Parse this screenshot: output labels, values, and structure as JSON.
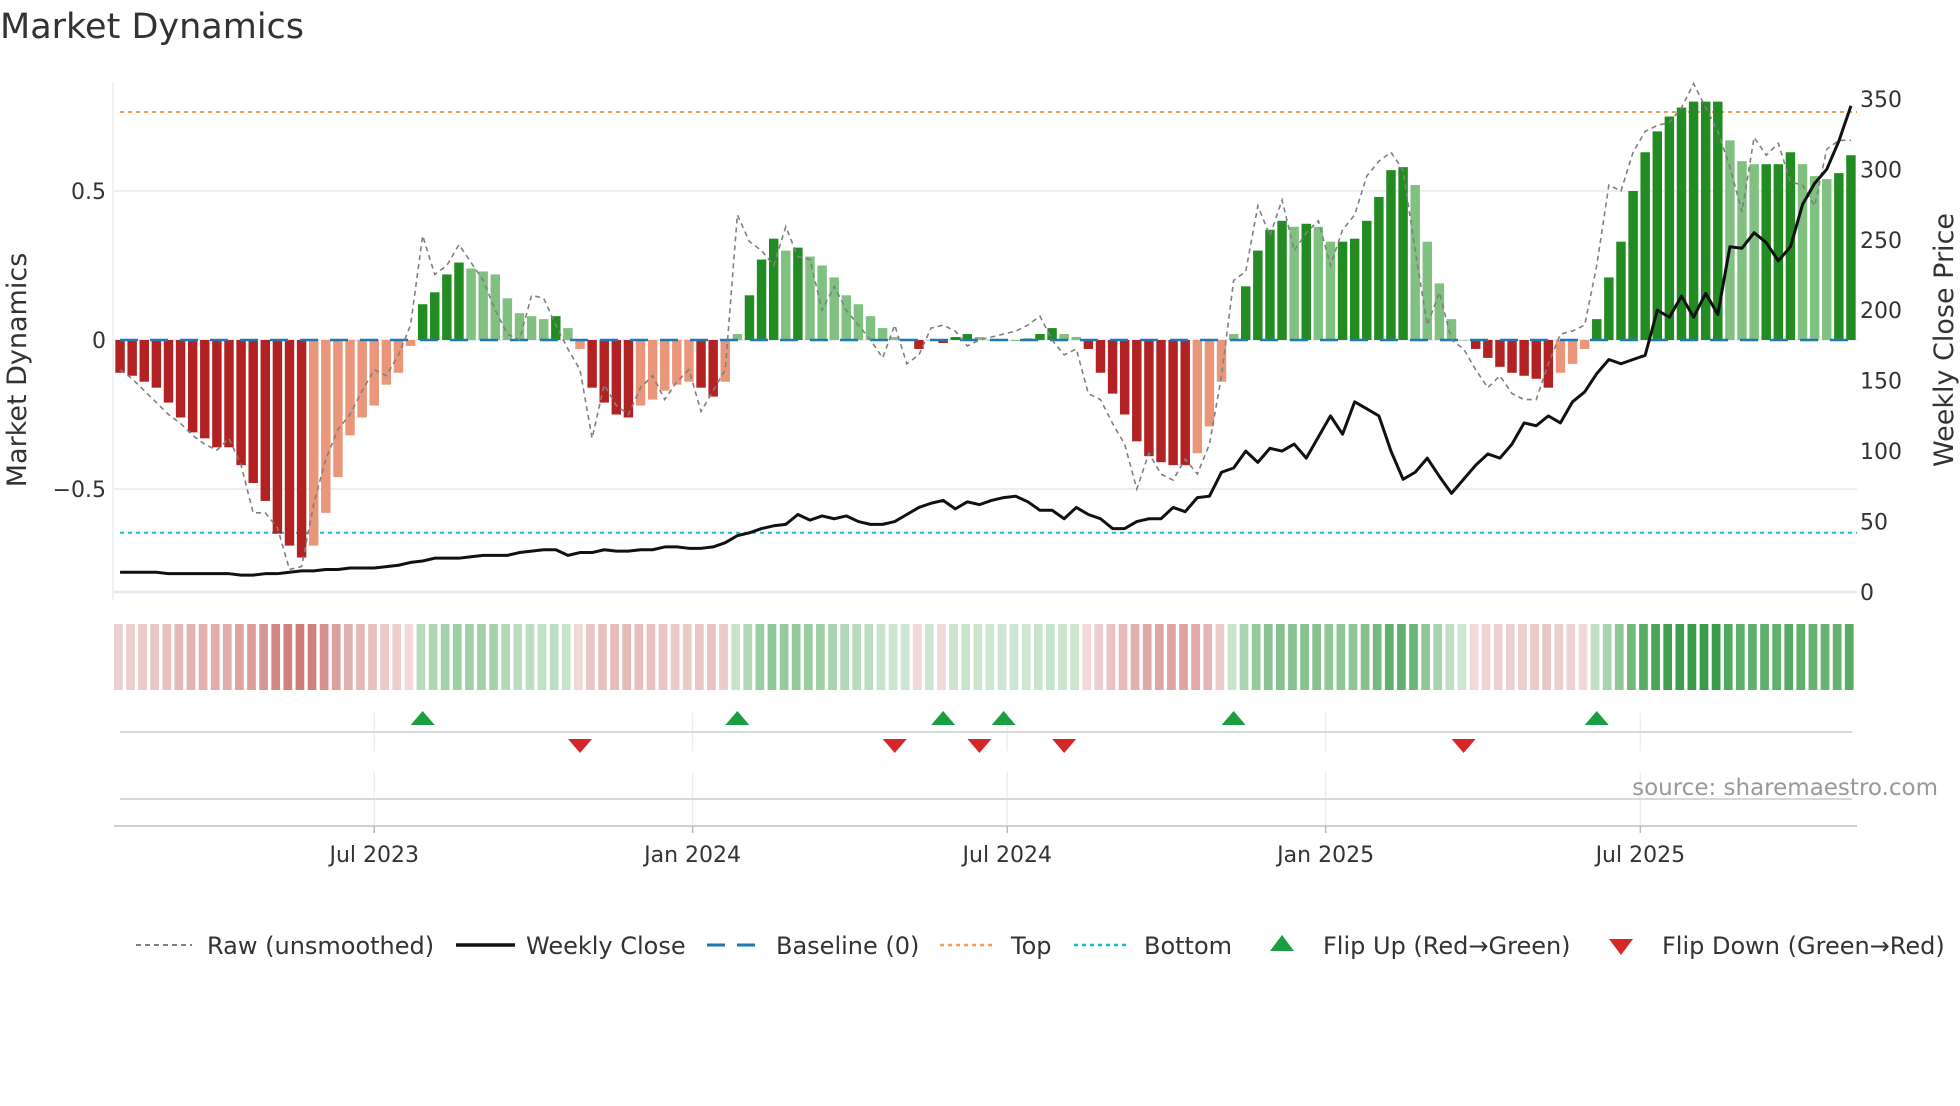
{
  "chart_data": {
    "type": "bar",
    "title": "Market Dynamics",
    "ylabel": "Market Dynamics",
    "y2label": "Weekly Close Price",
    "ylim": [
      -0.84,
      0.87
    ],
    "y2lim": [
      0,
      365
    ],
    "yticks": [
      -0.5,
      0,
      0.5
    ],
    "ytick_labels": [
      "−0.5",
      "0",
      "0.5"
    ],
    "y2ticks": [
      0,
      50,
      100,
      150,
      200,
      250,
      300,
      350
    ],
    "y2tick_labels": [
      "0",
      "50",
      "100",
      "150",
      "200",
      "250",
      "300",
      "350"
    ],
    "frequency": "weekly",
    "start_date": "2023-02-03",
    "xtick_labels": [
      "Jul 2023",
      "Jan 2024",
      "Jul 2024",
      "Jan 2025",
      "Jul 2025"
    ],
    "xtick_week_index": [
      21,
      47.3,
      73.3,
      99.6,
      125.6
    ],
    "top_level": 0.765,
    "bottom_level": -0.647,
    "baseline": 0,
    "smoothed": [
      -0.11,
      -0.12,
      -0.14,
      -0.16,
      -0.21,
      -0.26,
      -0.31,
      -0.33,
      -0.36,
      -0.36,
      -0.42,
      -0.48,
      -0.54,
      -0.65,
      -0.69,
      -0.73,
      -0.69,
      -0.58,
      -0.46,
      -0.32,
      -0.26,
      -0.22,
      -0.15,
      -0.11,
      -0.02,
      0.12,
      0.16,
      0.22,
      0.26,
      0.24,
      0.23,
      0.22,
      0.14,
      0.09,
      0.08,
      0.07,
      0.08,
      0.04,
      -0.03,
      -0.16,
      -0.21,
      -0.25,
      -0.26,
      -0.22,
      -0.2,
      -0.17,
      -0.15,
      -0.14,
      -0.16,
      -0.19,
      -0.14,
      0.02,
      0.15,
      0.27,
      0.34,
      0.3,
      0.31,
      0.28,
      0.25,
      0.21,
      0.15,
      0.12,
      0.08,
      0.04,
      0.01,
      0.0,
      -0.03,
      0.0,
      -0.01,
      0.01,
      0.02,
      0.01,
      0.0,
      0.0,
      0.0,
      0.005,
      0.02,
      0.04,
      0.02,
      0.01,
      -0.03,
      -0.11,
      -0.18,
      -0.25,
      -0.34,
      -0.39,
      -0.41,
      -0.42,
      -0.42,
      -0.38,
      -0.29,
      -0.14,
      0.02,
      0.18,
      0.3,
      0.37,
      0.4,
      0.38,
      0.39,
      0.38,
      0.33,
      0.33,
      0.34,
      0.4,
      0.48,
      0.57,
      0.58,
      0.52,
      0.33,
      0.19,
      0.07,
      0.0,
      -0.03,
      -0.06,
      -0.09,
      -0.11,
      -0.12,
      -0.13,
      -0.16,
      -0.11,
      -0.08,
      -0.03,
      0.07,
      0.21,
      0.33,
      0.5,
      0.63,
      0.7,
      0.75,
      0.78,
      0.8,
      0.8,
      0.8,
      0.67,
      0.6,
      0.59,
      0.59,
      0.59,
      0.63,
      0.59,
      0.55,
      0.54,
      0.56,
      0.62
    ],
    "raw": [
      -0.1,
      -0.13,
      -0.17,
      -0.21,
      -0.25,
      -0.28,
      -0.32,
      -0.35,
      -0.37,
      -0.33,
      -0.42,
      -0.58,
      -0.58,
      -0.63,
      -0.77,
      -0.76,
      -0.55,
      -0.4,
      -0.3,
      -0.25,
      -0.17,
      -0.1,
      -0.12,
      -0.05,
      0.05,
      0.35,
      0.22,
      0.25,
      0.32,
      0.26,
      0.2,
      0.1,
      0.02,
      0.0,
      0.15,
      0.14,
      0.05,
      -0.03,
      -0.1,
      -0.33,
      -0.15,
      -0.22,
      -0.25,
      -0.16,
      -0.12,
      -0.2,
      -0.14,
      -0.1,
      -0.24,
      -0.17,
      -0.1,
      0.42,
      0.33,
      0.3,
      0.25,
      0.38,
      0.28,
      0.27,
      0.1,
      0.18,
      0.1,
      0.05,
      0.0,
      -0.06,
      0.05,
      -0.08,
      -0.05,
      0.04,
      0.05,
      0.03,
      -0.02,
      0.0,
      0.01,
      0.02,
      0.03,
      0.05,
      0.08,
      0.0,
      -0.05,
      -0.03,
      -0.18,
      -0.2,
      -0.28,
      -0.35,
      -0.5,
      -0.38,
      -0.45,
      -0.47,
      -0.4,
      -0.45,
      -0.35,
      -0.12,
      0.2,
      0.23,
      0.45,
      0.35,
      0.47,
      0.3,
      0.36,
      0.4,
      0.25,
      0.37,
      0.42,
      0.55,
      0.6,
      0.63,
      0.57,
      0.3,
      0.05,
      0.16,
      0.0,
      -0.03,
      -0.1,
      -0.16,
      -0.12,
      -0.18,
      -0.2,
      -0.2,
      -0.08,
      0.02,
      0.03,
      0.05,
      0.25,
      0.52,
      0.5,
      0.63,
      0.7,
      0.72,
      0.73,
      0.78,
      0.86,
      0.78,
      0.7,
      0.58,
      0.43,
      0.68,
      0.62,
      0.66,
      0.53,
      0.52,
      0.45,
      0.64,
      0.67,
      0.67
    ],
    "weekly_close": [
      14,
      14,
      14,
      14,
      13,
      13,
      13,
      13,
      13,
      13,
      12,
      12,
      13,
      13,
      14,
      15,
      15,
      16,
      16,
      17,
      17,
      17,
      18,
      19,
      21,
      22,
      24,
      24,
      24,
      25,
      26,
      26,
      26,
      28,
      29,
      30,
      30,
      26,
      28,
      28,
      30,
      29,
      29,
      30,
      30,
      32,
      32,
      31,
      31,
      32,
      35,
      40,
      42,
      45,
      47,
      48,
      55,
      51,
      54,
      52,
      54,
      50,
      48,
      48,
      50,
      55,
      60,
      63,
      65,
      59,
      64,
      62,
      65,
      67,
      68,
      64,
      58,
      58,
      52,
      60,
      55,
      52,
      45,
      45,
      50,
      52,
      52,
      60,
      57,
      67,
      68,
      85,
      88,
      100,
      92,
      102,
      100,
      105,
      95,
      110,
      125,
      112,
      135,
      130,
      125,
      100,
      80,
      85,
      95,
      82,
      70,
      80,
      90,
      98,
      95,
      105,
      120,
      118,
      125,
      120,
      135,
      142,
      155,
      165,
      162,
      165,
      168,
      200,
      195,
      210,
      195,
      212,
      197,
      245,
      244,
      255,
      248,
      235,
      245,
      275,
      290,
      300,
      320,
      345
    ],
    "flip_up_week_index": [
      25,
      51,
      68,
      73,
      92,
      122
    ],
    "flip_down_week_index": [
      38,
      64,
      71,
      78,
      111
    ],
    "colors": {
      "strong_red": "#b22222",
      "fading_red": "#e9967a",
      "strong_green": "#228b22",
      "fading_green": "#80c080",
      "raw": "#808080",
      "close": "#111111",
      "baseline": "#1f77b4",
      "top": "#f0a050",
      "bottom": "#17becf",
      "flip_up": "#1a9e3f",
      "flip_down": "#d62728"
    },
    "legend": {
      "placement": "bottom",
      "items": [
        {
          "label": "Raw (unsmoothed)",
          "symbol": "dashed-gray"
        },
        {
          "label": "Weekly Close",
          "symbol": "solid-black"
        },
        {
          "label": "Baseline (0)",
          "symbol": "dashed-blue"
        },
        {
          "label": "Top",
          "symbol": "dotted-orange"
        },
        {
          "label": "Bottom",
          "symbol": "dotted-cyan"
        },
        {
          "label": "Flip Up (Red→Green)",
          "symbol": "triangle-up"
        },
        {
          "label": "Flip Down (Green→Red)",
          "symbol": "triangle-down"
        }
      ]
    },
    "source": "source: sharemaestro.com"
  }
}
